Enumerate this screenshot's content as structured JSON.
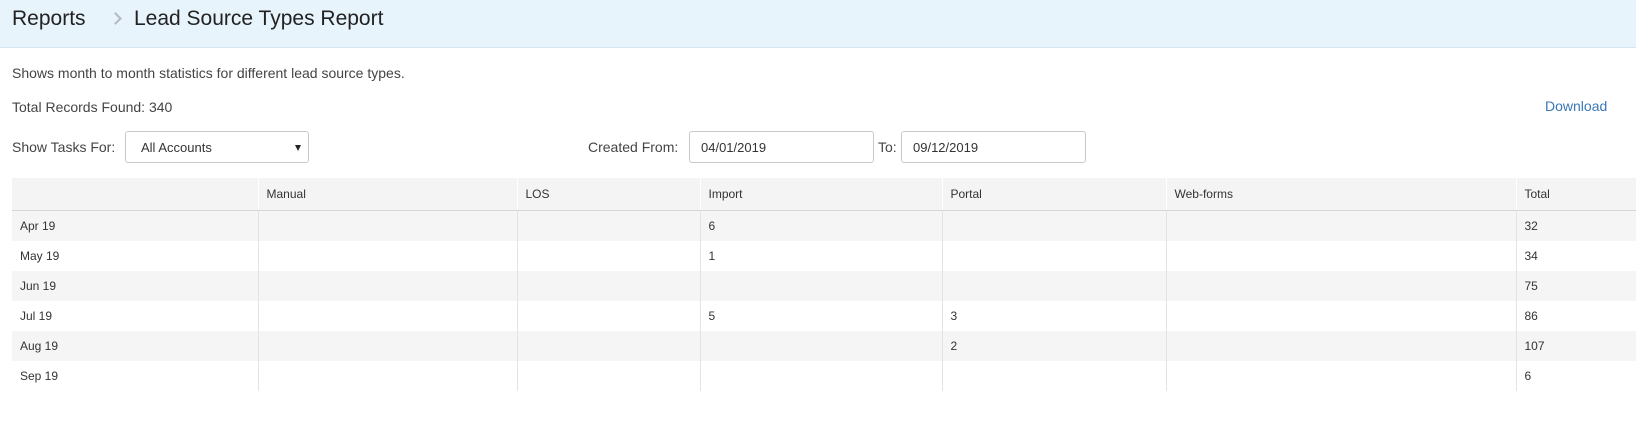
{
  "breadcrumb": {
    "root": "Reports",
    "current": "Lead Source Types Report"
  },
  "description": "Shows month to month statistics for different lead source types.",
  "total_records": "Total Records Found: 340",
  "download_label": "Download",
  "filters": {
    "show_tasks_label": "Show Tasks For:",
    "show_tasks_value": "All Accounts",
    "created_from_label": "Created From:",
    "created_from_value": "04/01/2019",
    "to_label": "To:",
    "to_value": "09/12/2019"
  },
  "table": {
    "headers": [
      "",
      "Manual",
      "LOS",
      "Import",
      "Portal",
      "Web-forms",
      "Total"
    ],
    "rows": [
      [
        "Apr 19",
        "",
        "",
        "6",
        "",
        "",
        "32"
      ],
      [
        "May 19",
        "",
        "",
        "1",
        "",
        "",
        "34"
      ],
      [
        "Jun 19",
        "",
        "",
        "",
        "",
        "",
        "75"
      ],
      [
        "Jul 19",
        "",
        "",
        "5",
        "3",
        "",
        "86"
      ],
      [
        "Aug 19",
        "",
        "",
        "",
        "2",
        "",
        "107"
      ],
      [
        "Sep 19",
        "",
        "",
        "",
        "",
        "",
        "6"
      ]
    ]
  },
  "colors": {
    "header_bg": "#e8f4fc",
    "link": "#3a78b8",
    "row_stripe": "#f5f5f5"
  }
}
